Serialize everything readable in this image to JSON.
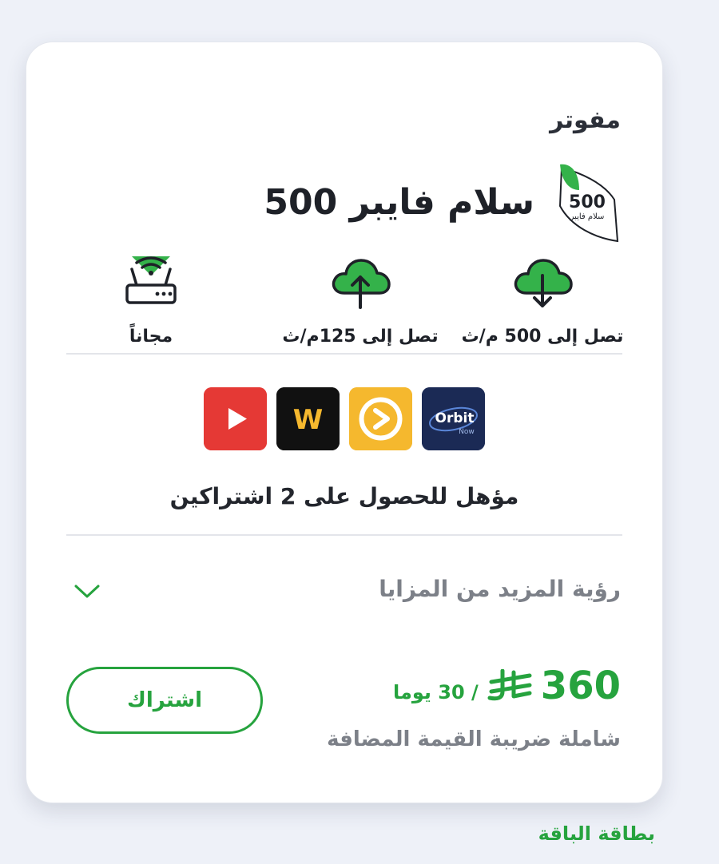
{
  "plan": {
    "type": "مفوتر",
    "name": "سلام فايبر 500",
    "badge_number": "500",
    "badge_text": "سلام فايبر"
  },
  "features": [
    {
      "icon": "cloud-download-icon",
      "label": "تصل إلى 500 م/ث"
    },
    {
      "icon": "cloud-upload-icon",
      "label": "تصل إلى 125م/ث"
    },
    {
      "icon": "wifi-router-icon",
      "label": "مجاناً"
    }
  ],
  "apps": [
    {
      "name": "youtube-logo",
      "color": "#e53935"
    },
    {
      "name": "weyyak-logo",
      "color": "#111111",
      "text": "W"
    },
    {
      "name": "viu-logo",
      "color": "#f5b82e"
    },
    {
      "name": "orbit-now-logo",
      "color": "#1b2a55",
      "text": "Orbit",
      "subtext": "Now"
    }
  ],
  "eligibility": "مؤهل للحصول على 2 اشتراكين",
  "more_benefits": "رؤية المزيد من المزايا",
  "price": {
    "amount": "360",
    "period": "/ 30 يوما",
    "vat_note": "شاملة ضريبة القيمة المضافة"
  },
  "subscribe_label": "اشتراك",
  "card_link": "بطاقة الباقة",
  "colors": {
    "accent": "#26a33e",
    "text": "#1e2128",
    "muted": "#7c8088",
    "background": "#eef1f8"
  }
}
